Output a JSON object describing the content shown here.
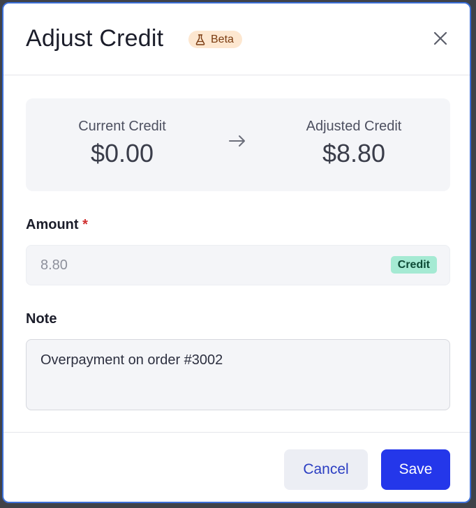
{
  "dialog": {
    "title": "Adjust Credit",
    "badge": "Beta",
    "close_icon": "close-icon"
  },
  "summary": {
    "current_label": "Current Credit",
    "current_value": "$0.00",
    "adjusted_label": "Adjusted Credit",
    "adjusted_value": "$8.80",
    "arrow_icon": "arrow-right-icon"
  },
  "amount": {
    "label": "Amount",
    "required_mark": "*",
    "value": "8.80",
    "type_tag": "Credit"
  },
  "note": {
    "label": "Note",
    "value": "Overpayment on order #3002"
  },
  "footer": {
    "cancel_label": "Cancel",
    "save_label": "Save"
  },
  "colors": {
    "accent": "#2437ea",
    "modal_border": "#3b6fd8",
    "beta_badge_bg": "#fde7d0",
    "credit_tag_bg": "#a5ead3",
    "required": "#d02f2f"
  }
}
